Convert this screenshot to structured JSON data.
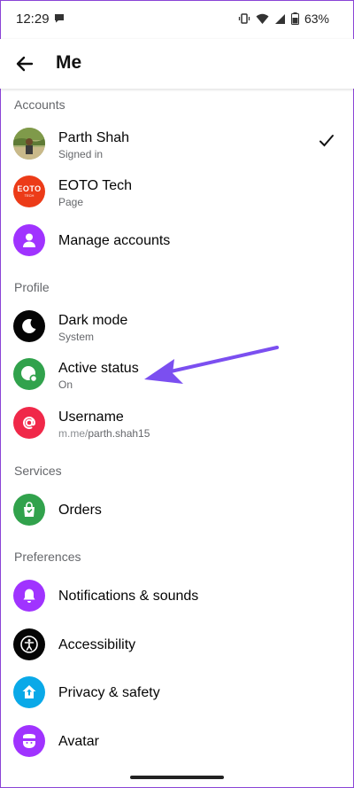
{
  "status_bar": {
    "time": "12:29",
    "battery": "63%"
  },
  "header": {
    "title": "Me"
  },
  "sections": {
    "accounts": "Accounts",
    "profile": "Profile",
    "services": "Services",
    "preferences": "Preferences"
  },
  "accounts": {
    "parth": {
      "name": "Parth Shah",
      "sub": "Signed in"
    },
    "eoto": {
      "name": "EOTO Tech",
      "sub": "Page",
      "logo_text": "EOTO",
      "logo_sub": "TECH"
    },
    "manage": {
      "label": "Manage accounts"
    }
  },
  "profile": {
    "dark_mode": {
      "label": "Dark mode",
      "sub": "System"
    },
    "active_status": {
      "label": "Active status",
      "sub": "On"
    },
    "username": {
      "label": "Username",
      "sub_prefix": "m.me/",
      "sub_value": "parth.shah15"
    }
  },
  "services": {
    "orders": "Orders"
  },
  "preferences": {
    "notifications": "Notifications & sounds",
    "accessibility": "Accessibility",
    "privacy": "Privacy & safety",
    "avatar": "Avatar"
  },
  "colors": {
    "purple": "#a033ff",
    "black": "#050505",
    "green": "#31a24c",
    "red": "#f02849",
    "blue": "#0aa9e8",
    "eoto_orange": "#ec3b18",
    "annotation_arrow": "#7b4ff0"
  }
}
